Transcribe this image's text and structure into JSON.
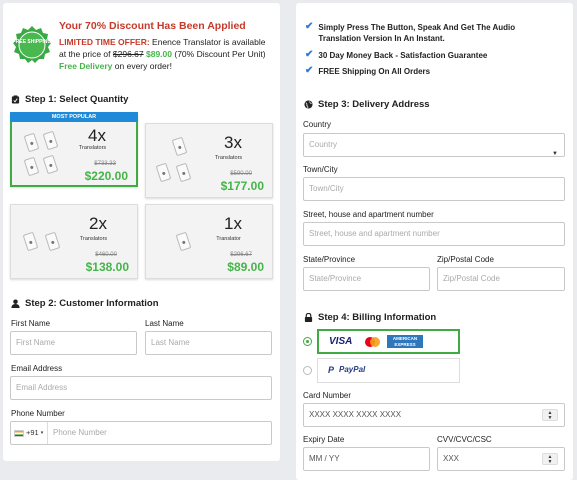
{
  "discount": {
    "badge_text": "FREE SHIPPING",
    "title": "Your 70% Discount Has Been Applied",
    "offer_label": "LIMITED TIME OFFER:",
    "offer_text": "Enence Translator is available at the price of",
    "old_price": "$296.67",
    "new_price": "$89.00",
    "discount_text": "(70% Discount Per Unit)",
    "free_delivery": "Free Delivery",
    "tail_text": "on every order!"
  },
  "step1": {
    "title": "Step 1: Select Quantity",
    "popular_label": "MOST POPULAR",
    "options": [
      {
        "qty": "4x",
        "label": "Translators",
        "old_price": "$733.33",
        "price": "$220.00"
      },
      {
        "qty": "3x",
        "label": "Translators",
        "old_price": "$590.00",
        "price": "$177.00"
      },
      {
        "qty": "2x",
        "label": "Translators",
        "old_price": "$460.00",
        "price": "$138.00"
      },
      {
        "qty": "1x",
        "label": "Translator",
        "old_price": "$296.67",
        "price": "$89.00"
      }
    ]
  },
  "step2": {
    "title": "Step 2: Customer Information",
    "first_name": {
      "label": "First Name",
      "placeholder": "First Name"
    },
    "last_name": {
      "label": "Last Name",
      "placeholder": "Last Name"
    },
    "email": {
      "label": "Email Address",
      "placeholder": "Email Address"
    },
    "phone": {
      "label": "Phone Number",
      "code": "+91",
      "placeholder": "Phone Number"
    }
  },
  "benefits": [
    "Simply Press The Button, Speak And Get The Audio Translation Version In An Instant.",
    "30 Day Money Back - Satisfaction Guarantee",
    "FREE Shipping On All Orders"
  ],
  "step3": {
    "title": "Step 3: Delivery Address",
    "country": {
      "label": "Country",
      "placeholder": "Country"
    },
    "city": {
      "label": "Town/City",
      "placeholder": "Town/City"
    },
    "street": {
      "label": "Street, house and apartment number",
      "placeholder": "Street, house and apartment number"
    },
    "state": {
      "label": "State/Province",
      "placeholder": "State/Province"
    },
    "zip": {
      "label": "Zip/Postal Code",
      "placeholder": "Zip/Postal Code"
    }
  },
  "step4": {
    "title": "Step 4: Billing Information",
    "visa_label": "VISA",
    "amex_label": "AMERICAN EXPRESS",
    "paypal_label": "PayPal",
    "card_number": {
      "label": "Card Number",
      "placeholder": "XXXX XXXX XXXX XXXX"
    },
    "expiry": {
      "label": "Expiry Date",
      "placeholder": "MM / YY"
    },
    "cvv": {
      "label": "CVV/CVC/CSC",
      "placeholder": "XXX"
    }
  },
  "colors": {
    "accent_green": "#45b549",
    "offer_red": "#c53a2b",
    "popular_blue": "#1f8bd8"
  }
}
